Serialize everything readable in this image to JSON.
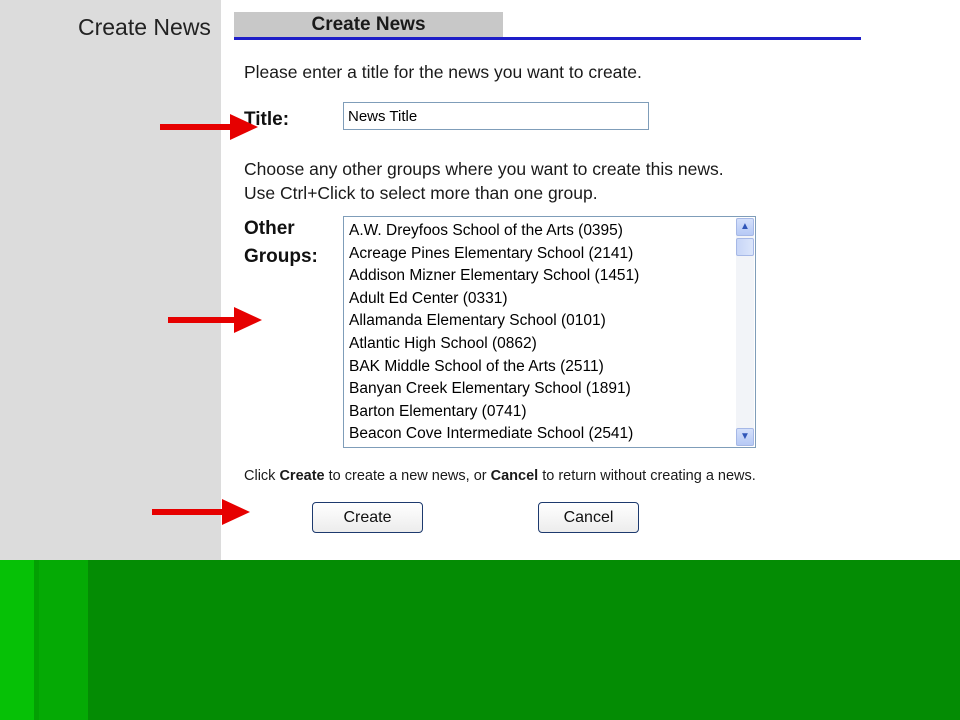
{
  "sidebar": {
    "title": "Create News"
  },
  "header": {
    "tab_label": "Create News"
  },
  "form": {
    "intro": "Please enter a title for the news you want to create.",
    "title_label": "Title:",
    "title_value": "News Title",
    "groups_help_line1": "Choose any other groups where you want to create this news.",
    "groups_help_line2": "Use Ctrl+Click to select more than one group.",
    "groups_label_line1": "Other",
    "groups_label_line2": "Groups:",
    "groups": [
      "A.W. Dreyfoos School of the Arts (0395)",
      "Acreage Pines Elementary School (2141)",
      "Addison Mizner Elementary School (1451)",
      "Adult Ed Center (0331)",
      "Allamanda Elementary School (0101)",
      "Atlantic High School (0862)",
      "BAK Middle School of the Arts (2511)",
      "Banyan Creek Elementary School (1891)",
      "Barton Elementary (0741)",
      "Beacon Cove Intermediate School (2541)"
    ],
    "footer": {
      "part1": "Click ",
      "create_word": "Create",
      "part2": " to create a new news, or ",
      "cancel_word": "Cancel",
      "part3": " to return without creating a news."
    },
    "create_label": "Create",
    "cancel_label": "Cancel"
  },
  "icons": {
    "scroll_up": "chevron-up-icon",
    "scroll_down": "chevron-down-icon",
    "arrow": "red-arrow-icon"
  },
  "colors": {
    "sidebar_bg": "#dcdcdc",
    "tab_underline": "#1e1ec8",
    "arrow": "#e60000",
    "green_band": "#048c04"
  }
}
